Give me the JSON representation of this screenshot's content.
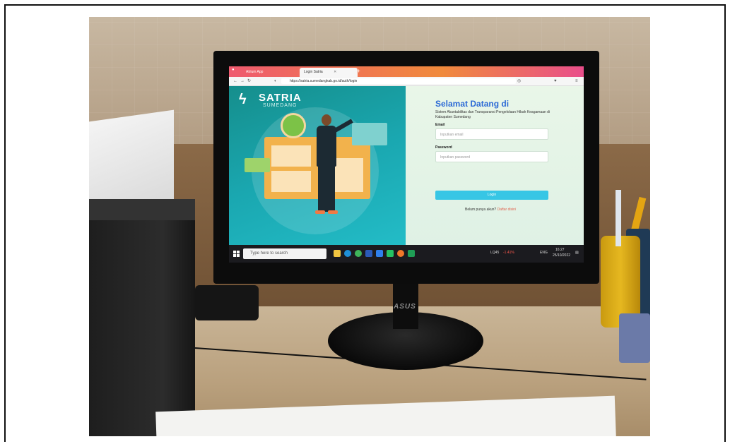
{
  "browser": {
    "tabs": [
      {
        "label": "Atrium App"
      },
      {
        "label": "Login Satria"
      }
    ],
    "url": "https://satria.sumedangkab.go.id/auth/login"
  },
  "login_page": {
    "logo_text": "SATRIA",
    "logo_subtext": "SUMEDANG",
    "title": "Selamat Datang di",
    "subtitle": "Sistem Akuntabilitas dan Transparansi Pengelolaan Hibah Keagamaan di Kabupaten Sumedang",
    "email_label": "Email",
    "email_placeholder": "Inputkan email",
    "password_label": "Password",
    "password_placeholder": "Inputkan password",
    "login_button": "Login",
    "signup_prompt": "Belum punya akun?",
    "signup_link": "Daftar disini"
  },
  "taskbar": {
    "search_placeholder": "Type here to search",
    "stock_ticker": "LQ45",
    "stock_change": "-1.41%",
    "language": "ENG",
    "time": "16:27",
    "date": "25/10/2022"
  },
  "monitor": {
    "brand": "ASUS"
  },
  "colors": {
    "accent_blue": "#2d6ad6",
    "button_cyan": "#37c6e5",
    "link_red": "#e1634f",
    "panel_teal": "#1aa7b0"
  }
}
